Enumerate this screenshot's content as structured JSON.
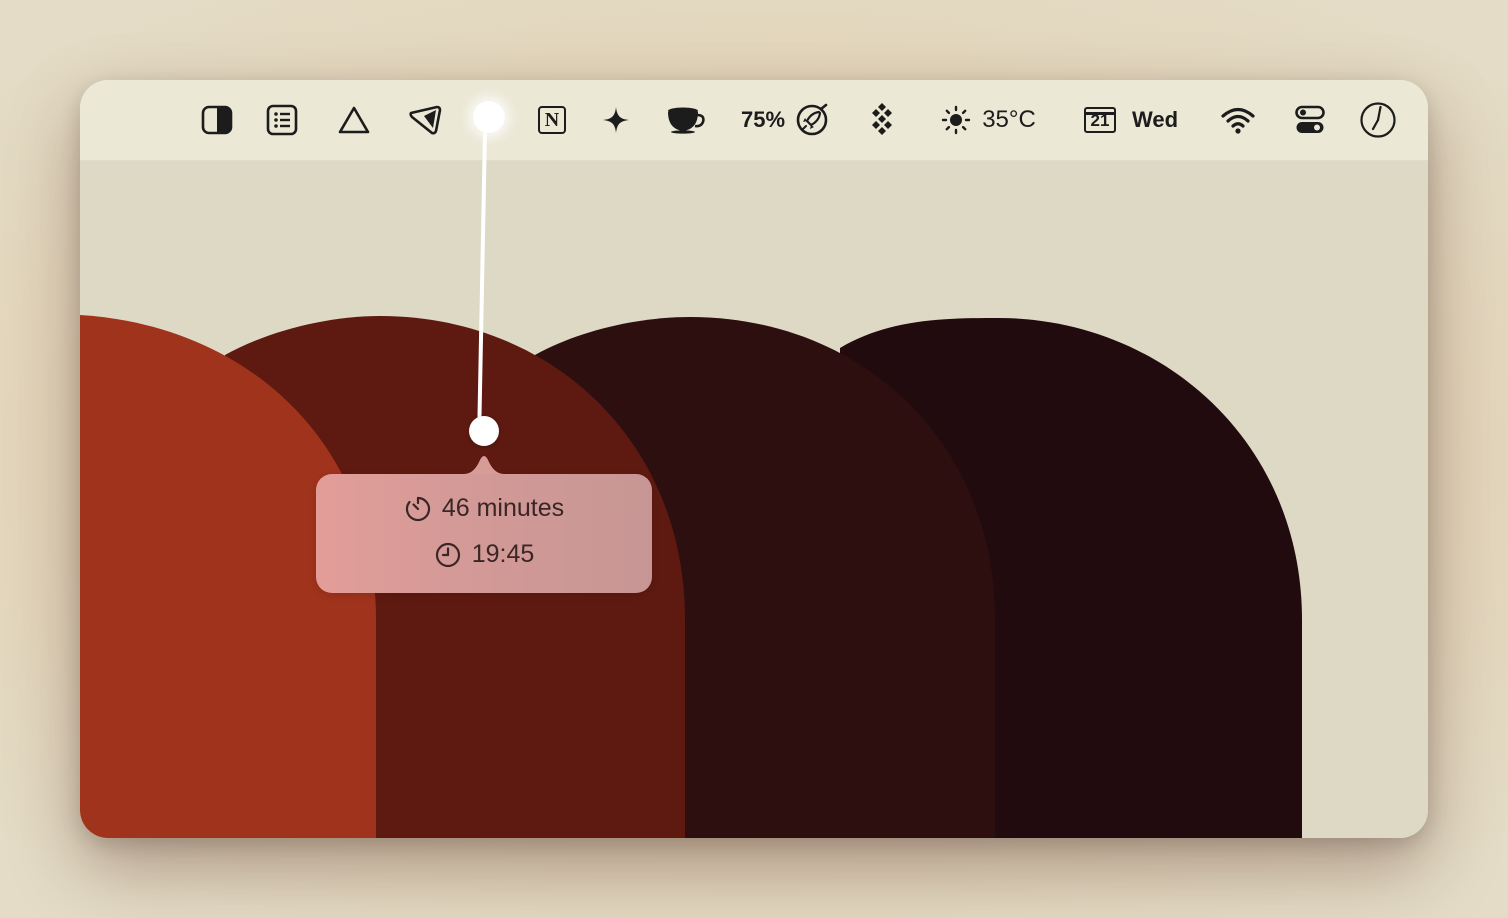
{
  "menubar": {
    "battery_percent_label": "75%",
    "weather_temp": "35°C",
    "calendar_day": "21",
    "calendar_weekday": "Wed",
    "notion_letter": "N"
  },
  "popover": {
    "duration_text": "46 minutes",
    "time_text": "19:45"
  },
  "colors": {
    "menubar_bg": "#ebe8d6",
    "wall_bg": "#ddd9c4",
    "arch_1": "#a0331c",
    "arch_2": "#5e1a11",
    "arch_3": "#2d0f10",
    "arch_4": "#220b0e",
    "popover_bg": "#d49a97"
  },
  "icons": [
    "contrast-icon",
    "list-icon",
    "triangle-icon",
    "tag-icon",
    "notion-icon",
    "sparkle-icon",
    "coffee-cup-icon",
    "rocket-gauge-icon",
    "diamond-grid-icon",
    "sun-icon",
    "calendar-icon",
    "wifi-icon",
    "control-center-icon",
    "clock-icon",
    "timer-icon"
  ]
}
